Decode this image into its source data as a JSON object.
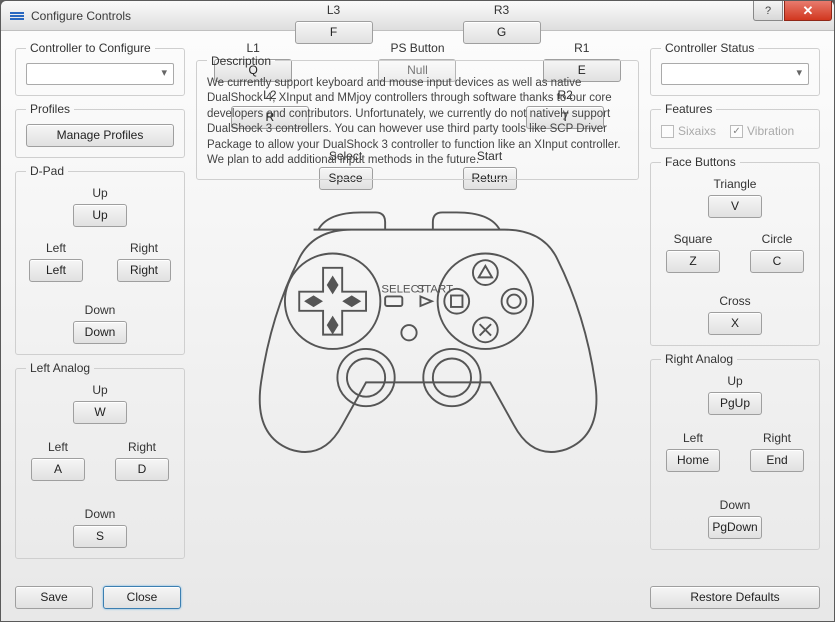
{
  "window": {
    "title": "Configure Controls"
  },
  "left": {
    "controller_to_configure": {
      "legend": "Controller to Configure",
      "value": ""
    },
    "profiles": {
      "legend": "Profiles",
      "manage": "Manage Profiles"
    },
    "dpad": {
      "legend": "D-Pad",
      "up": {
        "label": "Up",
        "value": "Up"
      },
      "left": {
        "label": "Left",
        "value": "Left"
      },
      "right": {
        "label": "Right",
        "value": "Right"
      },
      "down": {
        "label": "Down",
        "value": "Down"
      }
    },
    "left_analog": {
      "legend": "Left Analog",
      "up": {
        "label": "Up",
        "value": "W"
      },
      "left": {
        "label": "Left",
        "value": "A"
      },
      "right": {
        "label": "Right",
        "value": "D"
      },
      "down": {
        "label": "Down",
        "value": "S"
      }
    }
  },
  "mid": {
    "l1": {
      "label": "L1",
      "value": "Q"
    },
    "ps": {
      "label": "PS Button",
      "value": "Null"
    },
    "r1": {
      "label": "R1",
      "value": "E"
    },
    "l2": {
      "label": "L2",
      "value": "R"
    },
    "r2": {
      "label": "R2",
      "value": "T"
    },
    "select": {
      "label": "Select",
      "value": "Space"
    },
    "start": {
      "label": "Start",
      "value": "Return"
    },
    "l3": {
      "label": "L3",
      "value": "F"
    },
    "r3": {
      "label": "R3",
      "value": "G"
    },
    "description": {
      "legend": "Description",
      "text": "We currently support keyboard and mouse input devices as well as native DualShock 4, XInput and MMjoy controllers through software thanks to our core developers and contributors. Unfortunately, we currently do not natively support DualShock 3 controllers. You can however use third party tools like SCP Driver Package to allow your DualShock 3 controller to function like an XInput controller. We plan to add additional input methods in the future."
    }
  },
  "right": {
    "status": {
      "legend": "Controller Status",
      "value": ""
    },
    "features": {
      "legend": "Features",
      "sixaxis": "Sixaixs",
      "vibration": "Vibration"
    },
    "face": {
      "legend": "Face Buttons",
      "triangle": {
        "label": "Triangle",
        "value": "V"
      },
      "square": {
        "label": "Square",
        "value": "Z"
      },
      "circle": {
        "label": "Circle",
        "value": "C"
      },
      "cross": {
        "label": "Cross",
        "value": "X"
      }
    },
    "right_analog": {
      "legend": "Right Analog",
      "up": {
        "label": "Up",
        "value": "PgUp"
      },
      "left": {
        "label": "Left",
        "value": "Home"
      },
      "right": {
        "label": "Right",
        "value": "End"
      },
      "down": {
        "label": "Down",
        "value": "PgDown"
      }
    }
  },
  "footer": {
    "save": "Save",
    "close": "Close",
    "restore": "Restore Defaults"
  }
}
